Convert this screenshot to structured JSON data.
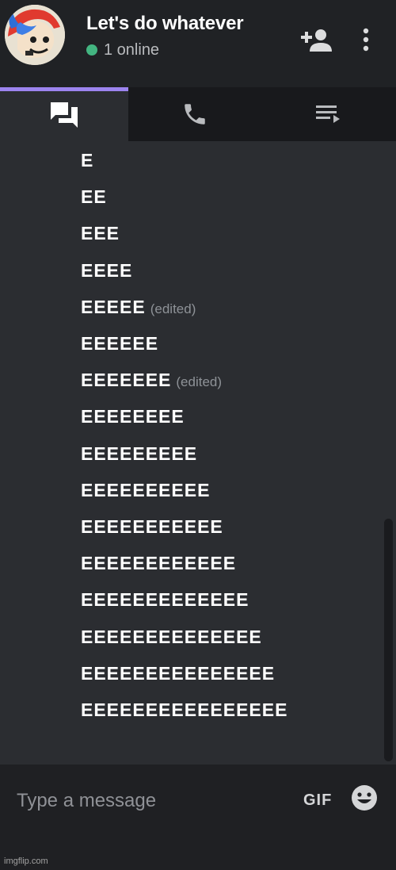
{
  "header": {
    "title": "Let's do whatever",
    "online_text": "1 online",
    "online_color": "#43b581"
  },
  "tabs": [
    {
      "icon": "chat-bubbles-icon",
      "active": true
    },
    {
      "icon": "phone-icon",
      "active": false
    },
    {
      "icon": "queue-list-icon",
      "active": false
    }
  ],
  "messages": [
    {
      "text": "E",
      "edited": ""
    },
    {
      "text": "EE",
      "edited": ""
    },
    {
      "text": "EEE",
      "edited": ""
    },
    {
      "text": "EEEE",
      "edited": ""
    },
    {
      "text": "EEEEE",
      "edited": "(edited)"
    },
    {
      "text": "EEEEEE",
      "edited": ""
    },
    {
      "text": "EEEEEEE",
      "edited": "(edited)"
    },
    {
      "text": "EEEEEEEE",
      "edited": ""
    },
    {
      "text": "EEEEEEEEE",
      "edited": ""
    },
    {
      "text": "EEEEEEEEEE",
      "edited": ""
    },
    {
      "text": "EEEEEEEEEEE",
      "edited": ""
    },
    {
      "text": "EEEEEEEEEEEE",
      "edited": ""
    },
    {
      "text": "EEEEEEEEEEEEE",
      "edited": ""
    },
    {
      "text": "EEEEEEEEEEEEEE",
      "edited": ""
    },
    {
      "text": "EEEEEEEEEEEEEEE",
      "edited": ""
    },
    {
      "text": "EEEEEEEEEEEEEEEE",
      "edited": ""
    }
  ],
  "composer": {
    "placeholder": "Type a message",
    "gif_label": "GIF"
  },
  "watermark": "imgflip.com",
  "colors": {
    "accent": "#9c84ef",
    "background": "#2b2d31"
  }
}
